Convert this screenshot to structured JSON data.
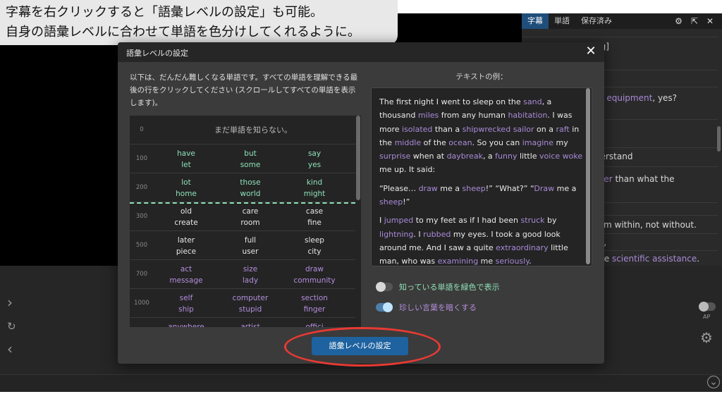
{
  "banner": {
    "line1": "字幕を右クリックすると「語彙レベルの設定」も可能。",
    "line2": "自身の語彙レベルに合わせて単語を色分けしてくれるように。"
  },
  "sidebar": {
    "tabs": [
      "字幕",
      "単語",
      "保存済み"
    ],
    "active_tab": "字幕",
    "rows": [
      {
        "parts": [
          {
            "t": "ng]",
            "c": ""
          }
        ]
      },
      {
        "parts": [
          {
            "t": "",
            "c": ""
          }
        ]
      },
      {
        "parts": [
          {
            "t": "ur ",
            "c": ""
          },
          {
            "t": "equipment",
            "c": "purple"
          },
          {
            "t": ", yes?",
            "c": ""
          }
        ]
      },
      {
        "parts": [
          {
            "t": "",
            "c": ""
          }
        ]
      },
      {
        "parts": [
          {
            "t": "derstand",
            "c": ""
          }
        ]
      },
      {
        "parts": [
          {
            "t": "ther",
            "c": "purple"
          },
          {
            "t": " than what the",
            "c": ""
          }
        ]
      },
      {
        "parts": [
          {
            "t": "",
            "c": ""
          }
        ]
      },
      {
        "parts": [
          {
            "t": "rom within, not without.",
            "c": ""
          }
        ]
      },
      {
        "parts": [
          {
            "t": "er,",
            "c": ""
          }
        ]
      },
      {
        "parts": [
          {
            "t": "ttle ",
            "c": ""
          },
          {
            "t": "scientific",
            "c": "purple"
          },
          {
            "t": " ",
            "c": ""
          },
          {
            "t": "assistance",
            "c": "purple"
          },
          {
            "t": ".",
            "c": ""
          }
        ]
      }
    ],
    "ap_label": "AP"
  },
  "modal": {
    "title": "語彙レベルの設定",
    "instructions": "以下は、だんだん難しくなる単語です。すべての単語を理解できる最後の行をクリックしてください (スクロールしてすべての単語を表示します)。",
    "example_label": "テキストの例：",
    "button_label": "語彙レベルの設定",
    "levels": [
      {
        "num": "0",
        "text": "まだ単語を知らない。",
        "words": []
      },
      {
        "num": "100",
        "color": "green",
        "words": [
          [
            "have",
            "let"
          ],
          [
            "but",
            "some"
          ],
          [
            "say",
            "yes"
          ]
        ]
      },
      {
        "num": "200",
        "color": "green",
        "words": [
          [
            "lot",
            "home"
          ],
          [
            "those",
            "world"
          ],
          [
            "kind",
            "might"
          ]
        ]
      },
      {
        "num": "300",
        "color": "white",
        "words": [
          [
            "old",
            "create"
          ],
          [
            "care",
            "room"
          ],
          [
            "case",
            "fine"
          ]
        ]
      },
      {
        "num": "500",
        "color": "white",
        "words": [
          [
            "later",
            "piece"
          ],
          [
            "full",
            "user"
          ],
          [
            "sleep",
            "city"
          ]
        ]
      },
      {
        "num": "700",
        "color": "purple",
        "words": [
          [
            "act",
            "message"
          ],
          [
            "size",
            "lady"
          ],
          [
            "draw",
            "community"
          ]
        ]
      },
      {
        "num": "1000",
        "color": "purple",
        "words": [
          [
            "self",
            "ship"
          ],
          [
            "computer",
            "stupid"
          ],
          [
            "section",
            "finger"
          ]
        ]
      },
      {
        "num": "",
        "color": "purple",
        "words": [
          [
            "anywhere",
            ""
          ],
          [
            "artist",
            ""
          ],
          [
            "offici",
            ""
          ]
        ]
      }
    ],
    "example_paragraphs": [
      [
        {
          "t": "The first night I went to sleep on the ",
          "c": ""
        },
        {
          "t": "sand",
          "c": "purple"
        },
        {
          "t": ", a thousand ",
          "c": ""
        },
        {
          "t": "miles",
          "c": "purple"
        },
        {
          "t": " from any human ",
          "c": ""
        },
        {
          "t": "habitation",
          "c": "purple"
        },
        {
          "t": ". I was more ",
          "c": ""
        },
        {
          "t": "isolated",
          "c": "purple"
        },
        {
          "t": " than a ",
          "c": ""
        },
        {
          "t": "shipwrecked",
          "c": "purple"
        },
        {
          "t": " ",
          "c": ""
        },
        {
          "t": "sailor",
          "c": "purple"
        },
        {
          "t": " on a ",
          "c": ""
        },
        {
          "t": "raft",
          "c": "purple"
        },
        {
          "t": " in the ",
          "c": ""
        },
        {
          "t": "middle",
          "c": "purple"
        },
        {
          "t": " of the ",
          "c": ""
        },
        {
          "t": "ocean",
          "c": "purple"
        },
        {
          "t": ". So you can ",
          "c": ""
        },
        {
          "t": "imagine",
          "c": "purple"
        },
        {
          "t": " my ",
          "c": ""
        },
        {
          "t": "surprise",
          "c": "purple"
        },
        {
          "t": " when at ",
          "c": ""
        },
        {
          "t": "daybreak",
          "c": "purple"
        },
        {
          "t": ", a ",
          "c": ""
        },
        {
          "t": "funny",
          "c": "purple"
        },
        {
          "t": " little ",
          "c": ""
        },
        {
          "t": "voice",
          "c": "purple"
        },
        {
          "t": " ",
          "c": ""
        },
        {
          "t": "woke",
          "c": "purple"
        },
        {
          "t": " me up. It said:",
          "c": ""
        }
      ],
      [
        {
          "t": "“Please… ",
          "c": ""
        },
        {
          "t": "draw",
          "c": "purple"
        },
        {
          "t": " me a ",
          "c": ""
        },
        {
          "t": "sheep",
          "c": "purple"
        },
        {
          "t": "!” “What?” “",
          "c": ""
        },
        {
          "t": "Draw",
          "c": "purple"
        },
        {
          "t": " me a ",
          "c": ""
        },
        {
          "t": "sheep",
          "c": "purple"
        },
        {
          "t": "!”",
          "c": ""
        }
      ],
      [
        {
          "t": "I ",
          "c": ""
        },
        {
          "t": "jumped",
          "c": "purple"
        },
        {
          "t": " to my feet as if I had been ",
          "c": ""
        },
        {
          "t": "struck",
          "c": "purple"
        },
        {
          "t": " by ",
          "c": ""
        },
        {
          "t": "lightning",
          "c": "purple"
        },
        {
          "t": ". I ",
          "c": ""
        },
        {
          "t": "rubbed",
          "c": "purple"
        },
        {
          "t": " my eyes. I took a good look around me. And I saw a quite ",
          "c": ""
        },
        {
          "t": "extraordinary",
          "c": "purple"
        },
        {
          "t": " little man, who was ",
          "c": ""
        },
        {
          "t": "examining",
          "c": "purple"
        },
        {
          "t": " me ",
          "c": ""
        },
        {
          "t": "seriously",
          "c": "purple"
        },
        {
          "t": ".",
          "c": ""
        }
      ]
    ],
    "toggles": [
      {
        "label": "知っている単語を緑色で表示",
        "state": "off",
        "color": "#8fe0b8"
      },
      {
        "label": "珍しい言葉を暗くする",
        "state": "on",
        "color": "#b48fdd"
      }
    ]
  },
  "colors": {
    "accent": "#1e62a0",
    "known_green": "#8fe0b8",
    "rare_purple": "#b48fdd",
    "highlight_red": "#e83a33"
  }
}
